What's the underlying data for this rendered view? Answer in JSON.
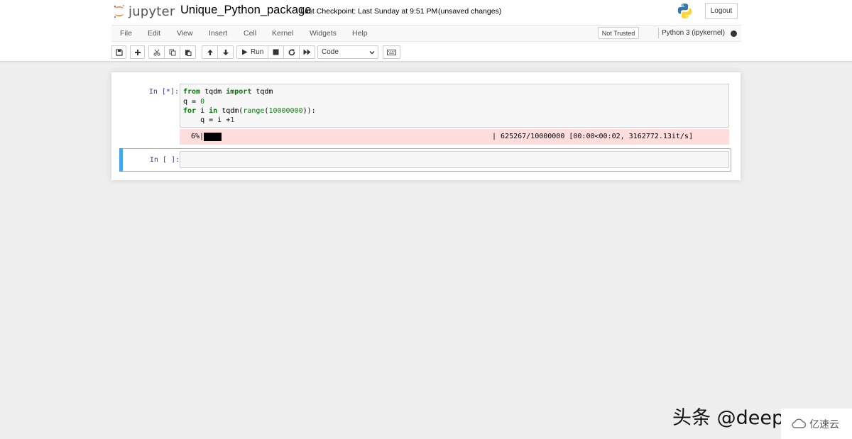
{
  "header": {
    "logo_text": "jupyter",
    "notebook_name": "Unique_Python_package",
    "checkpoint": "Last Checkpoint: Last Sunday at 9:51 PM",
    "autosave_status": "(unsaved changes)",
    "logout_label": "Logout"
  },
  "menu": {
    "items": [
      "File",
      "Edit",
      "View",
      "Insert",
      "Cell",
      "Kernel",
      "Widgets",
      "Help"
    ],
    "trust_label": "Not Trusted",
    "kernel_name": "Python 3 (ipykernel)",
    "kernel_status": "busy"
  },
  "toolbar": {
    "icons": [
      "save-icon",
      "plus-icon",
      "scissors-icon",
      "copy-icon",
      "paste-icon",
      "arrow-up-icon",
      "arrow-down-icon",
      "play-icon",
      "stop-icon",
      "restart-icon",
      "fast-forward-icon",
      "keyboard-icon"
    ],
    "run_label": "Run",
    "cell_type": "Code"
  },
  "cells": {
    "cell1": {
      "prompt": "In [*]:",
      "code": {
        "l1_kw1": "from",
        "l1_mod": " tqdm ",
        "l1_kw2": "import",
        "l1_name": " tqdm",
        "l2": "q = ",
        "l2_num": "0",
        "l3_kw1": "for",
        "l3_var": " i ",
        "l3_kw2": "in",
        "l3_call": " tqdm(",
        "l3_bi": "range",
        "l3_open": "(",
        "l3_num": "10000000",
        "l3_close": ")):",
        "l4": "    q = i +",
        "l4_num": "1"
      },
      "output": {
        "percent": "6%|",
        "progress_fraction": 0.0625,
        "stats": "| 625267/10000000 [00:00<00:02, 3162772.13it/s]"
      }
    },
    "cell2": {
      "prompt": "In [ ]:"
    }
  },
  "watermark": {
    "text": "头条 @deepdark",
    "brand": "亿速云"
  }
}
